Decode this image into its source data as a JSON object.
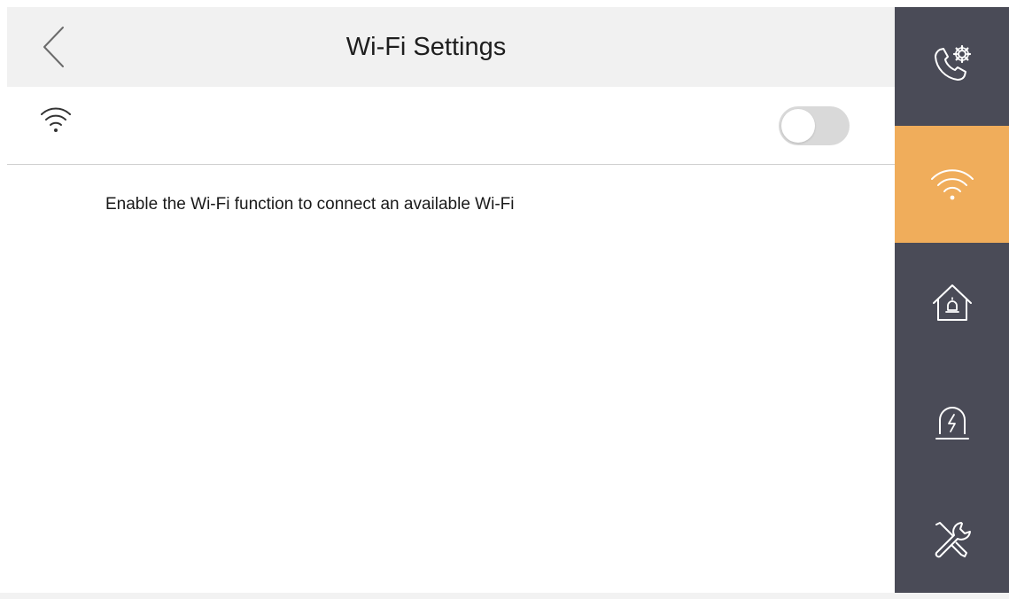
{
  "header": {
    "title": "Wi-Fi Settings"
  },
  "wifi": {
    "enabled": false,
    "hint": "Enable the Wi-Fi function to connect an available Wi-Fi"
  },
  "sidebar": {
    "items": [
      {
        "icon": "call-settings-icon",
        "active": false
      },
      {
        "icon": "wifi-icon",
        "active": true
      },
      {
        "icon": "home-alarm-icon",
        "active": false
      },
      {
        "icon": "alarm-light-icon",
        "active": false
      },
      {
        "icon": "tools-icon",
        "active": false
      }
    ]
  },
  "colors": {
    "sidebar_bg": "#4a4b57",
    "accent": "#f0ad5b",
    "header_bg": "#f1f1f1",
    "toggle_off": "#d9d9d9"
  }
}
